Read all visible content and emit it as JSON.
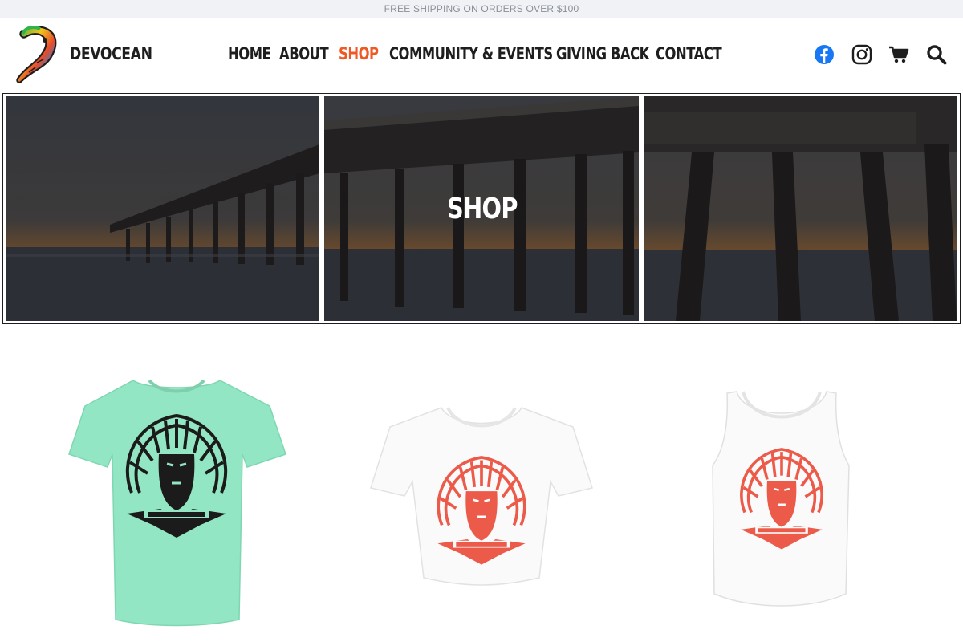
{
  "promo": {
    "text": "FREE SHIPPING ON ORDERS OVER $100"
  },
  "header": {
    "brand": "DEVOCEAN",
    "nav": [
      {
        "label": "HOME",
        "active": false
      },
      {
        "label": "ABOUT",
        "active": false
      },
      {
        "label": "SHOP",
        "active": true
      },
      {
        "label": "COMMUNITY & EVENTS",
        "active": false
      },
      {
        "label": "GIVING BACK",
        "active": false
      },
      {
        "label": "CONTACT",
        "active": false
      }
    ],
    "icons": [
      "facebook-icon",
      "instagram-icon",
      "cart-icon",
      "search-icon"
    ]
  },
  "hero": {
    "title": "SHOP"
  },
  "colors": {
    "accent": "#ef5a24",
    "facebook": "#1877f2",
    "text": "#1e1e1e",
    "promo_bg": "#f1f2f5",
    "shirt_mint": "#93e6c3",
    "print_red": "#ec5a4a"
  },
  "products": [
    {
      "name": "mint-tshirt",
      "garment": "tshirt",
      "color": "mint",
      "print": "black"
    },
    {
      "name": "white-crop-tee",
      "garment": "crop tee",
      "color": "white",
      "print": "red"
    },
    {
      "name": "white-tank",
      "garment": "tank",
      "color": "white",
      "print": "red"
    }
  ]
}
